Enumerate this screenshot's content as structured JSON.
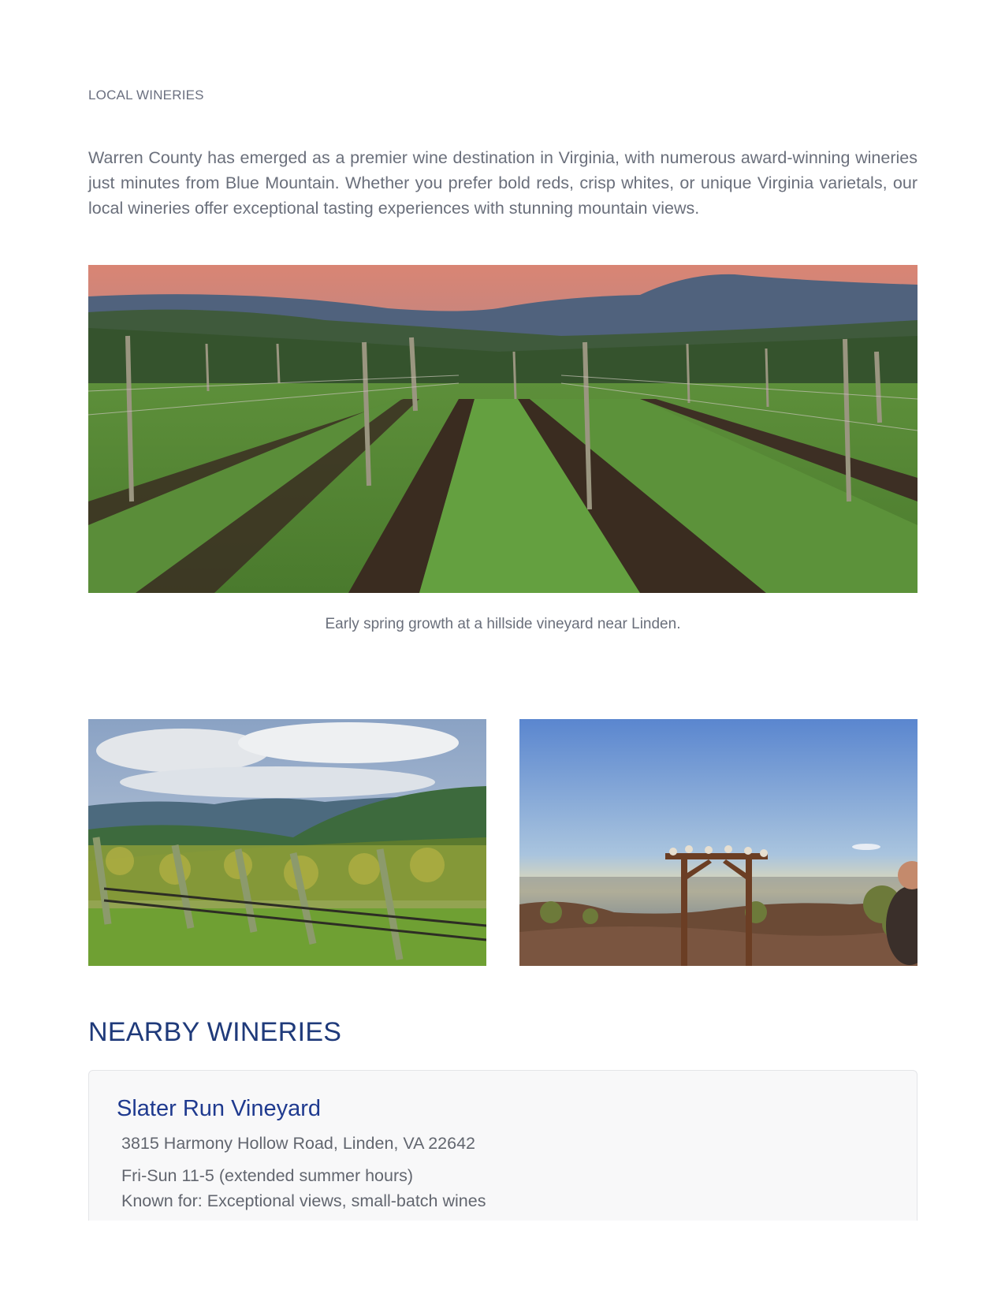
{
  "section_label": "LOCAL WINERIES",
  "intro": "Warren County has emerged as a premier wine destination in Virginia, with numerous award-winning wineries just minutes from Blue Mountain. Whether you prefer bold reds, crisp whites, or unique Virginia varietals, our local wineries offer exceptional tasting experiences with stunning mountain views.",
  "hero_caption": "Early spring growth at a hillside vineyard near Linden.",
  "nearby_heading": "NEARBY WINERIES",
  "wineries": [
    {
      "name": "Slater Run Vineyard",
      "address": "3815 Harmony Hollow Road, Linden, VA 22642",
      "hours": "Fri-Sun 11-5 (extended summer hours)",
      "known_for": "Known for: Exceptional views, small-batch wines"
    }
  ],
  "colors": {
    "heading_blue": "#1f3a7a",
    "body_gray": "#6a6f7b"
  }
}
